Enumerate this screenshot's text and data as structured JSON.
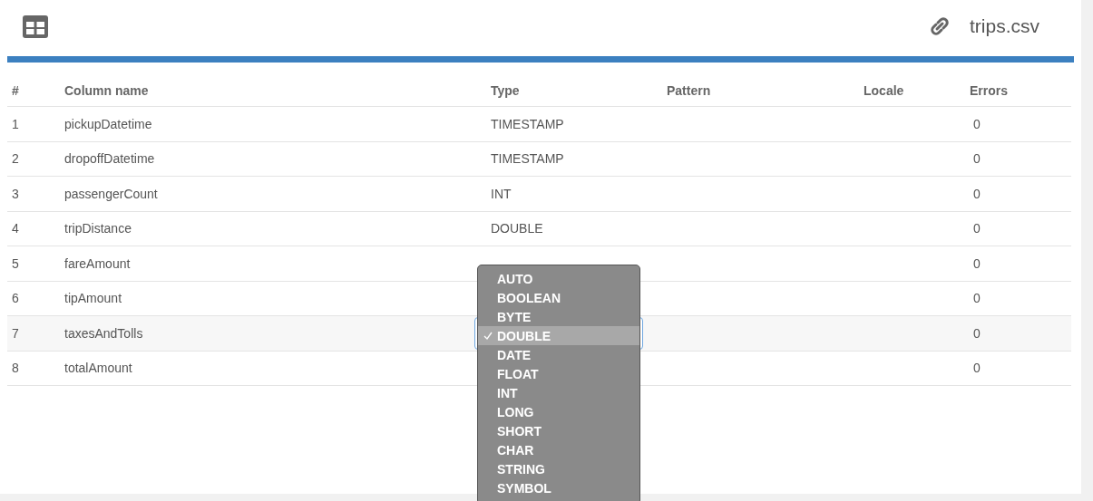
{
  "header": {
    "file_name": "trips.csv"
  },
  "table": {
    "columns": [
      "#",
      "Column name",
      "Type",
      "Pattern",
      "Locale",
      "Errors"
    ],
    "rows": [
      {
        "index": "1",
        "name": "pickupDatetime",
        "type": "TIMESTAMP",
        "errors": "0",
        "editing": false
      },
      {
        "index": "2",
        "name": "dropoffDatetime",
        "type": "TIMESTAMP",
        "errors": "0",
        "editing": false
      },
      {
        "index": "3",
        "name": "passengerCount",
        "type": "INT",
        "errors": "0",
        "editing": false
      },
      {
        "index": "4",
        "name": "tripDistance",
        "type": "DOUBLE",
        "errors": "0",
        "editing": false
      },
      {
        "index": "5",
        "name": "fareAmount",
        "errors": "0",
        "editing": false
      },
      {
        "index": "6",
        "name": "tipAmount",
        "errors": "0",
        "editing": false
      },
      {
        "index": "7",
        "name": "taxesAndTolls",
        "errors": "0",
        "editing": true
      },
      {
        "index": "8",
        "name": "totalAmount",
        "errors": "0",
        "editing": false
      }
    ]
  },
  "type_menu": {
    "options": [
      {
        "label": "AUTO",
        "selected": false
      },
      {
        "label": "BOOLEAN",
        "selected": false
      },
      {
        "label": "BYTE",
        "selected": false
      },
      {
        "label": "DOUBLE",
        "selected": true
      },
      {
        "label": "DATE",
        "selected": false
      },
      {
        "label": "FLOAT",
        "selected": false
      },
      {
        "label": "INT",
        "selected": false
      },
      {
        "label": "LONG",
        "selected": false
      },
      {
        "label": "SHORT",
        "selected": false
      },
      {
        "label": "CHAR",
        "selected": false
      },
      {
        "label": "STRING",
        "selected": false
      },
      {
        "label": "SYMBOL",
        "selected": false
      }
    ]
  }
}
